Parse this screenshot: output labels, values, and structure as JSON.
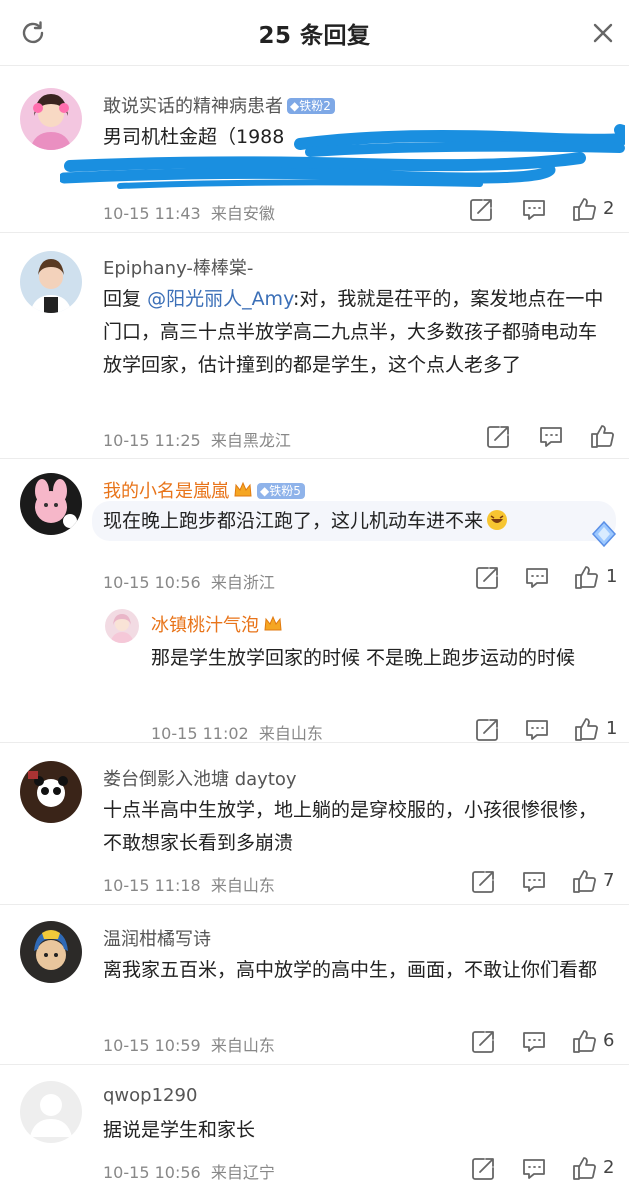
{
  "header": {
    "title": "25 条回复"
  },
  "comments": [
    {
      "user": "敢说实话的精神病患者",
      "badge": "铁粉2",
      "text": "男司机杜金超（1988",
      "time": "10-15 11:43",
      "location": "来自安徽",
      "likes": "2"
    },
    {
      "user": "Epiphany-棒棒棠-",
      "reply_prefix": "回复",
      "mention": "@阳光丽人_Amy",
      "text": ":对，我就是茌平的，案发地点在一中门口，高三十点半放学高二九点半，大多数孩子都骑电动车放学回家，估计撞到的都是学生，这个点人老多了",
      "time": "10-15 11:25",
      "location": "来自黑龙江",
      "likes": ""
    },
    {
      "user": "我的小名是嵐嵐",
      "badge": "铁粉5",
      "text": "现在晚上跑步都沿江跑了，这儿机动车进不来",
      "time": "10-15 10:56",
      "location": "来自浙江",
      "likes": "1"
    },
    {
      "user": "冰镇桃汁气泡",
      "text": "那是学生放学回家的时候 不是晚上跑步运动的时候",
      "time": "10-15 11:02",
      "location": "来自山东",
      "likes": "1"
    },
    {
      "user": "娄台倒影入池塘 daytoy",
      "text": "十点半高中生放学，地上躺的是穿校服的，小孩很惨很惨，不敢想家长看到多崩溃",
      "time": "10-15 11:18",
      "location": "来自山东",
      "likes": "7"
    },
    {
      "user": "温润柑橘写诗",
      "text": "离我家五百米，高中放学的高中生，画面，不敢让你们看都",
      "time": "10-15 10:59",
      "location": "来自山东",
      "likes": "6"
    },
    {
      "user": "qwop1290",
      "text": "据说是学生和家长",
      "time": "10-15 10:56",
      "location": "来自辽宁",
      "likes": "2"
    }
  ],
  "icons": {
    "refresh": "refresh-icon",
    "close": "close-icon",
    "share": "share-icon",
    "comment": "comment-icon",
    "like": "thumbs-up-icon"
  },
  "colors": {
    "mention": "#3b6fb7",
    "vip_name": "#e8741a",
    "badge_blue": "#7ea8e6",
    "redaction": "#1a8fe0"
  }
}
